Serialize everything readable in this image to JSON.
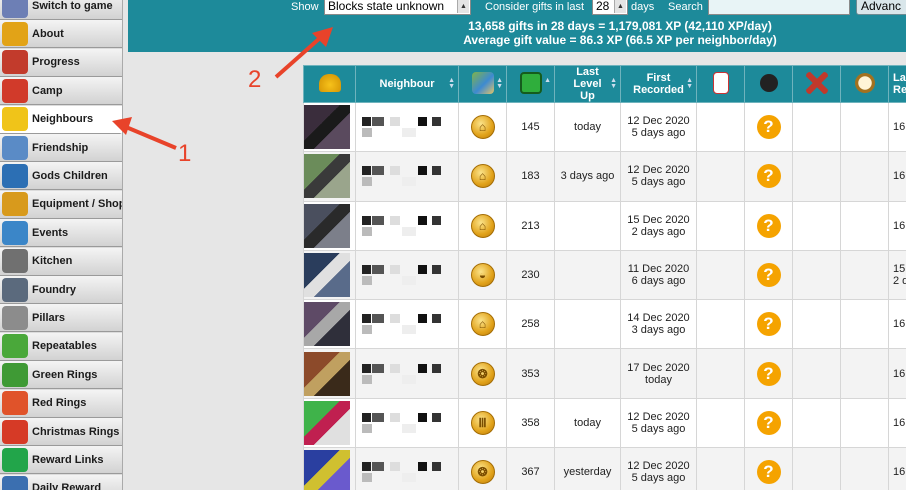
{
  "sidebar": {
    "items": [
      {
        "label": "Switch to game",
        "icon": "switch-game-icon",
        "color": "#6d7fb5"
      },
      {
        "label": "About",
        "icon": "daf2-logo-icon",
        "color": "#e2a317"
      },
      {
        "label": "Progress",
        "icon": "progress-cubes-icon",
        "color": "#c23b2c"
      },
      {
        "label": "Camp",
        "icon": "camp-tent-icon",
        "color": "#d13a2a"
      },
      {
        "label": "Neighbours",
        "icon": "neighbours-helmet-icon",
        "color": "#f0c419"
      },
      {
        "label": "Friendship",
        "icon": "friendship-icon",
        "color": "#5a8bc6"
      },
      {
        "label": "Gods Children",
        "icon": "gods-children-icon",
        "color": "#2c6fb4"
      },
      {
        "label": "Equipment / Shop",
        "icon": "equipment-chest-icon",
        "color": "#d89a1c"
      },
      {
        "label": "Events",
        "icon": "events-icon",
        "color": "#3b86c8"
      },
      {
        "label": "Kitchen",
        "icon": "kitchen-pot-icon",
        "color": "#707070"
      },
      {
        "label": "Foundry",
        "icon": "foundry-anvil-icon",
        "color": "#5b6a7d"
      },
      {
        "label": "Pillars",
        "icon": "pillars-icon",
        "color": "#8c8c8c"
      },
      {
        "label": "Repeatables",
        "icon": "repeatables-arrows-icon",
        "color": "#4aa83a"
      },
      {
        "label": "Green Rings",
        "icon": "green-ring-icon",
        "color": "#3f9a35"
      },
      {
        "label": "Red Rings",
        "icon": "red-ring-icon",
        "color": "#e0532a"
      },
      {
        "label": "Christmas Rings",
        "icon": "christmas-ring-icon",
        "color": "#d63a26"
      },
      {
        "label": "Reward Links",
        "icon": "reward-gem-icon",
        "color": "#22a54a"
      },
      {
        "label": "Daily Reward",
        "icon": "daily-reward-icon",
        "color": "#3b6fb0"
      }
    ],
    "active_index": 4
  },
  "topbar": {
    "show_label": "Show",
    "show_value": "Blocks state unknown",
    "consider_label": "Consider gifts in last",
    "days_value": "28",
    "days_label": "days",
    "search_label": "Search",
    "search_value": "",
    "advanced_label": "Advanc",
    "stats_line1": "13,658 gifts in 28 days = 1,179,081 XP (42,110 XP/day)",
    "stats_line2": "Average gift value = 86.3 XP (66.5 XP per neighbor/day)",
    "bg_color": "#1d8a9a"
  },
  "table": {
    "headers": {
      "neighbour": "Neighbour",
      "last_level_up": "Last Level Up",
      "first_recorded": "First Recorded",
      "last_partial": "La Re"
    },
    "header_icons": [
      "helmet-icon",
      "region-map-icon",
      "level-up-arrow-icon",
      "note-icon",
      "bomb-icon",
      "windmill-icon",
      "clock-icon"
    ],
    "rows": [
      {
        "level": "145",
        "last_level_up": "today",
        "first_date": "12 Dec 2020",
        "first_ago": "5 days ago",
        "extra": "16",
        "extra2": ""
      },
      {
        "level": "183",
        "last_level_up": "3 days ago",
        "first_date": "12 Dec 2020",
        "first_ago": "5 days ago",
        "extra": "16",
        "extra2": ""
      },
      {
        "level": "213",
        "last_level_up": "",
        "first_date": "15 Dec 2020",
        "first_ago": "2 days ago",
        "extra": "16",
        "extra2": ""
      },
      {
        "level": "230",
        "last_level_up": "",
        "first_date": "11 Dec 2020",
        "first_ago": "6 days ago",
        "extra": "15",
        "extra2": "2 d"
      },
      {
        "level": "258",
        "last_level_up": "",
        "first_date": "14 Dec 2020",
        "first_ago": "3 days ago",
        "extra": "16",
        "extra2": ""
      },
      {
        "level": "353",
        "last_level_up": "",
        "first_date": "17 Dec 2020",
        "first_ago": "today",
        "extra": "16",
        "extra2": ""
      },
      {
        "level": "358",
        "last_level_up": "today",
        "first_date": "12 Dec 2020",
        "first_ago": "5 days ago",
        "extra": "16",
        "extra2": ""
      },
      {
        "level": "367",
        "last_level_up": "yesterday",
        "first_date": "12 Dec 2020",
        "first_ago": "5 days ago",
        "extra": "16",
        "extra2": ""
      }
    ],
    "region_icons": [
      "pagoda-coin-icon",
      "pagoda-coin-icon",
      "pagoda-coin-icon",
      "helmet-coin-icon",
      "pagoda-coin-icon",
      "shell-coin-icon",
      "temple-coin-icon",
      "shell-coin-icon"
    ],
    "blocks_glyph": "?",
    "header_color": "#1d8a9a"
  },
  "annotations": {
    "num1": "1",
    "num2": "2",
    "color": "#e8432a"
  }
}
